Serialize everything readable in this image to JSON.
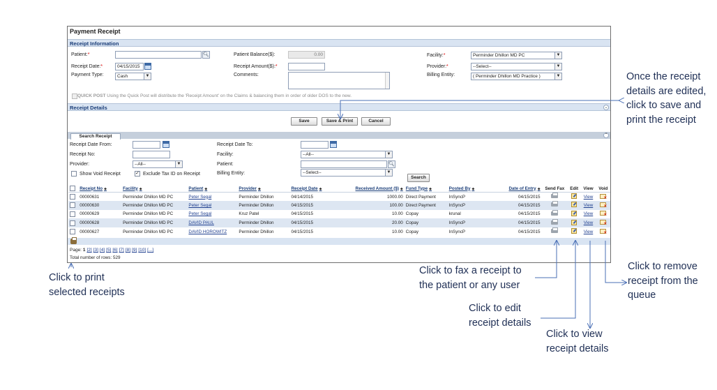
{
  "window": {
    "title": "Payment Receipt"
  },
  "receipt_info": {
    "section_label": "Receipt Information",
    "patient_label": "Patient:",
    "patient_balance_label": "Patient Balance($):",
    "patient_balance_value": "0.00",
    "facility_label": "Facility:",
    "facility_value": "Perminder Dhillon MD PC",
    "receipt_date_label": "Receipt Date:",
    "receipt_date_value": "04/15/2015",
    "receipt_amount_label": "Receipt Amount($):",
    "provider_label": "Provider:",
    "provider_value": "--Select--",
    "payment_type_label": "Payment Type:",
    "payment_type_value": "Cash",
    "comments_label": "Comments:",
    "billing_entity_label": "Billing Entity:",
    "billing_entity_value": "( Perminder Dhillon MD Practice )",
    "quick_post_label": "QUICK POST",
    "quick_post_text": "Using the Quick Post will distribute the 'Receipt Amount' on the Claims & balancing them in order of older DOS to the new."
  },
  "receipt_details": {
    "section_label": "Receipt Details",
    "save_label": "Save",
    "save_print_label": "Save & Print",
    "cancel_label": "Cancel"
  },
  "search": {
    "tab_label": "Search Receipt",
    "date_from_label": "Receipt Date From:",
    "date_to_label": "Receipt Date To:",
    "receipt_no_label": "Receipt No:",
    "facility_label": "Facility:",
    "facility_value": "--All--",
    "provider_label": "Provider:",
    "provider_value": "--All--",
    "patient_label": "Patient:",
    "show_void_label": "Show Void Receipt",
    "exclude_tax_label": "Exclude Tax ID on Receipt",
    "billing_entity_label": "Billing Entity:",
    "billing_entity_value": "--Select--",
    "search_button": "Search"
  },
  "grid": {
    "headers": {
      "receipt_no": "Receipt No",
      "facility": "Facility",
      "patient": "Patient",
      "provider": "Provider",
      "receipt_date": "Receipt Date",
      "received_amount": "Received Amount ($)",
      "fund_type": "Fund Type",
      "posted_by": "Posted By",
      "date_of_entry": "Date of Entry",
      "send_fax": "Send Fax",
      "edit": "Edit",
      "view": "View",
      "void": "Void"
    },
    "rows": [
      {
        "receipt_no": "00000631",
        "facility": "Perminder Dhillon MD PC",
        "patient": "Peter Segal",
        "provider": "Perminder Dhillon",
        "receipt_date": "04/14/2015",
        "amount": "1000.00",
        "fund_type": "Direct Payment",
        "posted_by": "InSyncP",
        "date_of_entry": "04/15/2015",
        "view": "View"
      },
      {
        "receipt_no": "00000630",
        "facility": "Perminder Dhillon MD PC",
        "patient": "Peter Segal",
        "provider": "Perminder Dhillon",
        "receipt_date": "04/15/2015",
        "amount": "100.00",
        "fund_type": "Direct Payment",
        "posted_by": "InSyncP",
        "date_of_entry": "04/15/2015",
        "view": "View"
      },
      {
        "receipt_no": "00000629",
        "facility": "Perminder Dhillon MD PC",
        "patient": "Peter Segal",
        "provider": "Kruz Patel",
        "receipt_date": "04/15/2015",
        "amount": "10.00",
        "fund_type": "Copay",
        "posted_by": "krunal",
        "date_of_entry": "04/15/2015",
        "view": "View"
      },
      {
        "receipt_no": "00000628",
        "facility": "Perminder Dhillon MD PC",
        "patient": "DAVID PAUL",
        "provider": "Perminder Dhillon",
        "receipt_date": "04/15/2015",
        "amount": "20.00",
        "fund_type": "Copay",
        "posted_by": "InSyncP",
        "date_of_entry": "04/15/2015",
        "view": "View"
      },
      {
        "receipt_no": "00000627",
        "facility": "Perminder Dhillon MD PC",
        "patient": "DAVID HOROWITZ",
        "provider": "Perminder Dhillon",
        "receipt_date": "04/15/2015",
        "amount": "10.00",
        "fund_type": "Copay",
        "posted_by": "InSyncP",
        "date_of_entry": "04/15/2015",
        "view": "View"
      }
    ]
  },
  "pager": {
    "label": "Page:",
    "current": "1",
    "pages": [
      "[2]",
      "[3]",
      "[4]",
      "[5]",
      "[6]",
      "[7]",
      "[8]",
      "[9]",
      "[10]",
      "[...]"
    ],
    "total_rows": "Total number of rows: 529"
  },
  "annotations": {
    "save_print": [
      "Once the receipt",
      "details are edited,",
      "click to save and",
      "print the receipt"
    ],
    "print": [
      "Click to print",
      "selected receipts"
    ],
    "fax": [
      "Click to fax a receipt to",
      "the patient or any user"
    ],
    "edit": [
      "Click to edit",
      "receipt details"
    ],
    "view": [
      "Click to view",
      "receipt details"
    ],
    "void": [
      "Click to remove",
      "receipt from the",
      "queue"
    ]
  },
  "colors": {
    "section_bar": "#d9e4f2",
    "row_alt": "#dde6f2",
    "link": "#1f3f8f",
    "required": "#dd0000",
    "annotation": "#1f2f55",
    "arrow": "#4a6fb5"
  },
  "icons": [
    "search-icon",
    "calendar-icon",
    "fax-icon",
    "edit-icon",
    "void-icon",
    "print-icon",
    "collapse-icon",
    "chevron-down-icon"
  ]
}
